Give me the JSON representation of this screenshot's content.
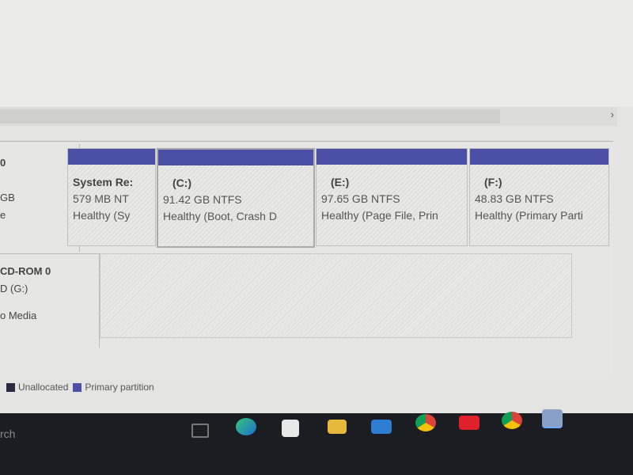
{
  "disk0": {
    "label": "0",
    "size": "GB",
    "extra": "e"
  },
  "cdrom": {
    "label": "CD-ROM 0",
    "drive": "D (G:)",
    "status": "o Media"
  },
  "partitions": [
    {
      "name": "System Re:",
      "size": "579 MB NT",
      "status": "Healthy (Sy"
    },
    {
      "name": "(C:)",
      "size": "91.42 GB NTFS",
      "status": "Healthy (Boot, Crash D"
    },
    {
      "name": "(E:)",
      "size": "97.65 GB NTFS",
      "status": "Healthy (Page File, Prin"
    },
    {
      "name": "(F:)",
      "size": "48.83 GB NTFS",
      "status": "Healthy (Primary Parti"
    }
  ],
  "legend": [
    {
      "label": "Unallocated",
      "color": "#2a2a40"
    },
    {
      "label": "Primary partition",
      "color": "#4b4fa6"
    }
  ],
  "taskbar": {
    "search": "rch",
    "icons": [
      "task-view",
      "edge",
      "store",
      "file-explorer",
      "mail",
      "chrome",
      "youtube",
      "chrome-2",
      "disk-management"
    ]
  },
  "scroll_arrow": "›"
}
